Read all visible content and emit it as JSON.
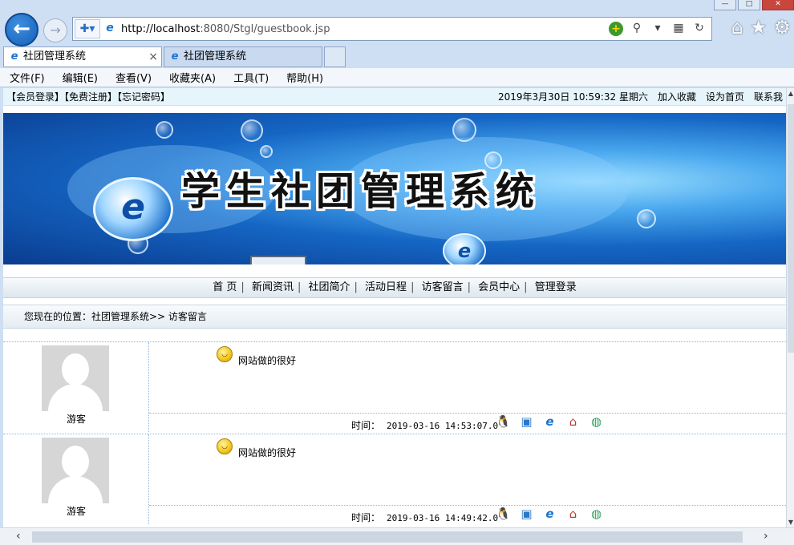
{
  "window": {
    "minimize": "—",
    "maximize": "□",
    "close": "✕"
  },
  "address_bar": {
    "url_host": "http://localhost",
    "url_rest": ":8080/Stgl/guestbook.jsp"
  },
  "tabs": [
    {
      "label": "社团管理系统"
    },
    {
      "label": "社团管理系统"
    }
  ],
  "menu": [
    "文件(F)",
    "编辑(E)",
    "查看(V)",
    "收藏夹(A)",
    "工具(T)",
    "帮助(H)"
  ],
  "topbar": {
    "left_links": "【会员登录】【免费注册】【忘记密码】",
    "datetime": "2019年3月30日 10:59:32  星期六",
    "add_favorite": "加入收藏",
    "set_home": "设为首页",
    "contact": "联系我"
  },
  "banner": {
    "title": "学生社团管理系统"
  },
  "nav": [
    "首 页",
    "新闻资讯",
    "社团简介",
    "活动日程",
    "访客留言",
    "会员中心",
    "管理登录"
  ],
  "breadcrumb": "您现在的位置：社团管理系统>> 访客留言",
  "messages": [
    {
      "user": "游客",
      "text": "网站做的很好",
      "time_label": "时间：",
      "time": "2019-03-16 14:53:07.0"
    },
    {
      "user": "游客",
      "text": "网站做的很好",
      "time_label": "时间：",
      "time": "2019-03-16 14:49:42.0"
    }
  ],
  "icons": {
    "contact_icons": [
      "qq-icon",
      "contact-card-icon",
      "ie-icon",
      "home-icon",
      "globe-icon"
    ]
  }
}
